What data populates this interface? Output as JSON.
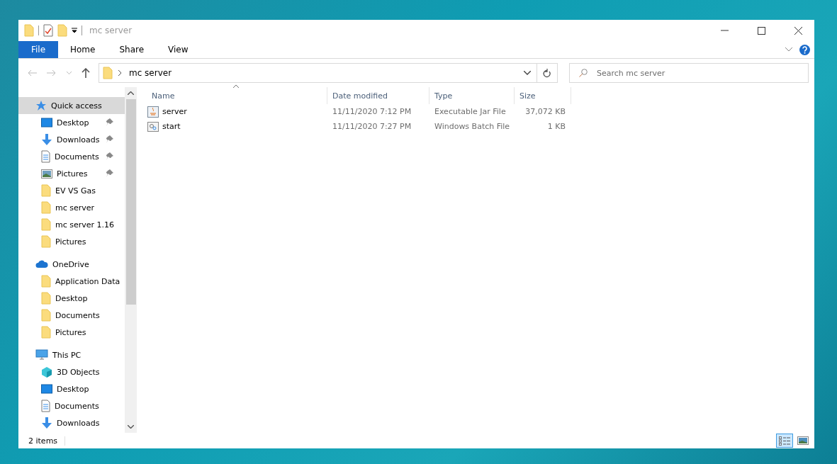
{
  "window": {
    "title": "mc server"
  },
  "ribbon": {
    "tabs": [
      {
        "label": "File",
        "selected": true
      },
      {
        "label": "Home",
        "selected": false
      },
      {
        "label": "Share",
        "selected": false
      },
      {
        "label": "View",
        "selected": false
      }
    ]
  },
  "address": {
    "path": "mc server"
  },
  "search": {
    "placeholder": "Search mc server"
  },
  "sidebar": {
    "groups": [
      {
        "label": "Quick access",
        "kind": "star",
        "selected": true,
        "children": [
          {
            "label": "Desktop",
            "kind": "desktop",
            "pinned": true
          },
          {
            "label": "Downloads",
            "kind": "download",
            "pinned": true
          },
          {
            "label": "Documents",
            "kind": "document",
            "pinned": true
          },
          {
            "label": "Pictures",
            "kind": "pictures",
            "pinned": true
          },
          {
            "label": "EV VS Gas",
            "kind": "folder",
            "pinned": false
          },
          {
            "label": "mc server",
            "kind": "folder",
            "pinned": false
          },
          {
            "label": "mc server 1.16",
            "kind": "folder",
            "pinned": false
          },
          {
            "label": "Pictures",
            "kind": "folder",
            "pinned": false
          }
        ]
      },
      {
        "label": "OneDrive",
        "kind": "cloud",
        "selected": false,
        "children": [
          {
            "label": "Application Data",
            "kind": "folder",
            "pinned": false
          },
          {
            "label": "Desktop",
            "kind": "folder",
            "pinned": false
          },
          {
            "label": "Documents",
            "kind": "folder",
            "pinned": false
          },
          {
            "label": "Pictures",
            "kind": "folder",
            "pinned": false
          }
        ]
      },
      {
        "label": "This PC",
        "kind": "pc",
        "selected": false,
        "children": [
          {
            "label": "3D Objects",
            "kind": "cube",
            "pinned": false
          },
          {
            "label": "Desktop",
            "kind": "desktop",
            "pinned": false
          },
          {
            "label": "Documents",
            "kind": "document",
            "pinned": false
          },
          {
            "label": "Downloads",
            "kind": "download",
            "pinned": false
          }
        ]
      }
    ]
  },
  "table": {
    "columns": [
      "Name",
      "Date modified",
      "Type",
      "Size"
    ],
    "rows": [
      {
        "name": "server",
        "kind": "jar",
        "date": "11/11/2020 7:12 PM",
        "type": "Executable Jar File",
        "size": "37,072 KB"
      },
      {
        "name": "start",
        "kind": "batch",
        "date": "11/11/2020 7:27 PM",
        "type": "Windows Batch File",
        "size": "1 KB"
      }
    ]
  },
  "status_bar": {
    "count": "2 items",
    "views": [
      {
        "kind": "details",
        "selected": true
      },
      {
        "kind": "large",
        "selected": false
      }
    ]
  }
}
